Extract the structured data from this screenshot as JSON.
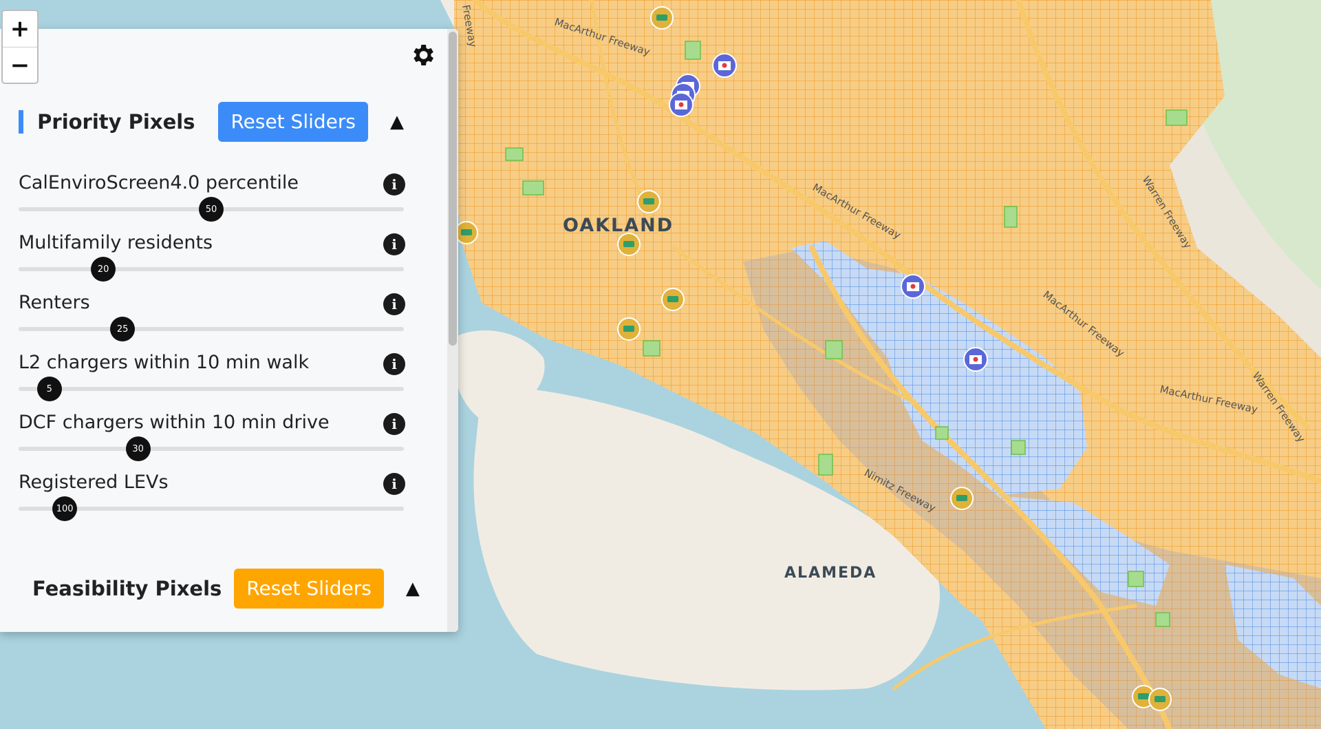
{
  "map": {
    "place_labels": [
      "OAKLAND",
      "ALAMEDA"
    ],
    "road_labels": [
      "MacArthur Freeway",
      "MacArthur Freeway",
      "MacArthur Freeway",
      "MacArthur Freeway",
      "Warren Freeway",
      "Warren Freeway",
      "Nimitz Freeway",
      "Freeway"
    ],
    "colors": {
      "water": "#aad3df",
      "land": "#f1ece3",
      "priority_pixel": "#3b82f6",
      "feasibility_pixel": "#f5a623",
      "park": "#9fd58a",
      "road_major": "#f8c96a"
    },
    "markers": {
      "hospital_icon": "hospital-icon",
      "charger_icon": "ev-charger-icon"
    }
  },
  "zoom": {
    "in_label": "+",
    "out_label": "−"
  },
  "panel": {
    "settings_icon": "gear-icon",
    "priority": {
      "title": "Priority Pixels",
      "reset_label": "Reset Sliders",
      "toggle_glyph": "▲",
      "color": "#3b8cf8"
    },
    "sliders": [
      {
        "label": "CalEnviroScreen4.0 percentile",
        "value": "50",
        "fraction": 0.5
      },
      {
        "label": "Multifamily residents",
        "value": "20",
        "fraction": 0.22
      },
      {
        "label": "Renters",
        "value": "25",
        "fraction": 0.27
      },
      {
        "label": "L2 chargers within 10 min walk",
        "value": "5",
        "fraction": 0.08
      },
      {
        "label": "DCF chargers within 10 min drive",
        "value": "30",
        "fraction": 0.31
      },
      {
        "label": "Registered LEVs",
        "value": "100",
        "fraction": 0.12
      }
    ],
    "feasibility": {
      "title": "Feasibility Pixels",
      "reset_label": "Reset Sliders",
      "toggle_glyph": "▲",
      "color": "#ffa500"
    }
  }
}
